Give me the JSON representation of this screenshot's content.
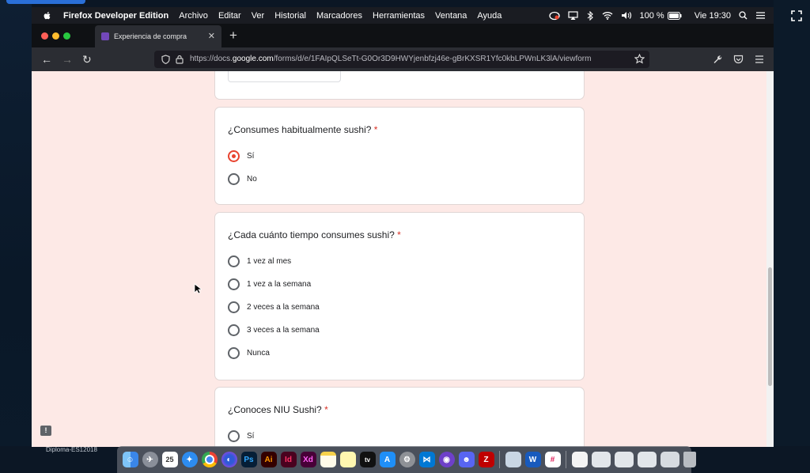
{
  "menubar": {
    "app_name": "Firefox Developer Edition",
    "items": [
      "Archivo",
      "Editar",
      "Ver",
      "Historial",
      "Marcadores",
      "Herramientas",
      "Ventana",
      "Ayuda"
    ],
    "battery": "100 %",
    "clock": "Vie 19:30"
  },
  "browser": {
    "tab_title": "Experiencia de compra",
    "url_prefix": "https://docs.",
    "url_domain": "google.com",
    "url_rest": "/forms/d/e/1FAIpQLSeTt-G0Or3D9HWYjenbfzj46e-gBrKXSR1Yfc0kbLPWnLK3lA/viewform"
  },
  "form": {
    "q1": {
      "title": "¿Consumes habitualmente sushi?",
      "required_mark": "*",
      "options": [
        "Sí",
        "No"
      ]
    },
    "q2": {
      "title": "¿Cada cuánto tiempo consumes sushi?",
      "required_mark": "*",
      "options": [
        "1 vez al mes",
        "1 vez a la semana",
        "2 veces a la semana",
        "3 veces a la semana",
        "Nunca"
      ]
    },
    "q3": {
      "title": "¿Conoces NIU Sushi?",
      "required_mark": "*",
      "options": [
        "Sí"
      ]
    },
    "feedback_glyph": "!"
  },
  "desktop": {
    "label": "Diploma-ES12018"
  },
  "dock": {
    "calendar_day": "25",
    "apps": [
      "Finder",
      "Launchpad",
      "Calendar",
      "Safari",
      "Chrome",
      "Firefox",
      "Ps",
      "Ai",
      "Id",
      "Xd",
      "Notes",
      "Stickies",
      "Apple TV",
      "App Store",
      "System Preferences",
      "VS Code",
      "GitHub",
      "Discord",
      "FileZilla",
      "Preview",
      "Word",
      "Slack",
      "Documents",
      "Trash"
    ]
  },
  "colors": {
    "accent": "#e8432f",
    "required": "#d93025",
    "page_bg": "#fde9e6"
  }
}
